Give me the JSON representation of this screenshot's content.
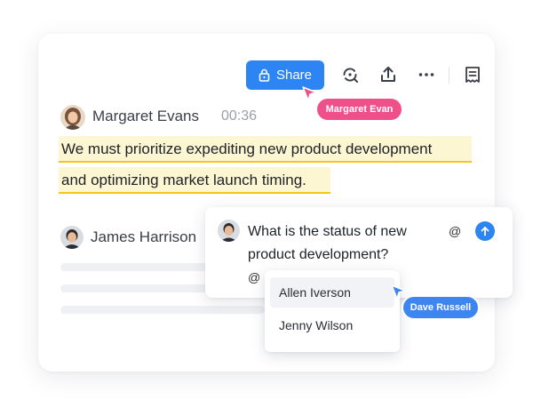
{
  "toolbar": {
    "share_label": "Share",
    "icons": [
      "lock-icon",
      "refresh-search-icon",
      "share-upload-icon",
      "more-icon",
      "notes-icon"
    ]
  },
  "transcript": {
    "speaker1": {
      "name": "Margaret Evans",
      "timestamp": "00:36",
      "line1": "We must prioritize expediting new product  development",
      "line2": "and optimizing market launch timing."
    },
    "speaker2": {
      "name": "James Harrison"
    }
  },
  "cursors": {
    "margaret": {
      "label": "Margaret Evan",
      "color": "#f0508a"
    },
    "dave": {
      "label": "Dave Russell",
      "color": "#3d86ef"
    }
  },
  "comment": {
    "text": "What is the status of new product development?",
    "mention_symbol": "@",
    "input_prefix": "@"
  },
  "mention_dropdown": {
    "options": [
      {
        "label": "Allen Iverson"
      },
      {
        "label": "Jenny Wilson"
      }
    ]
  },
  "colors": {
    "accent": "#2d84f3",
    "highlight_bg": "#fdf6d2",
    "highlight_underline": "#f5c518"
  }
}
